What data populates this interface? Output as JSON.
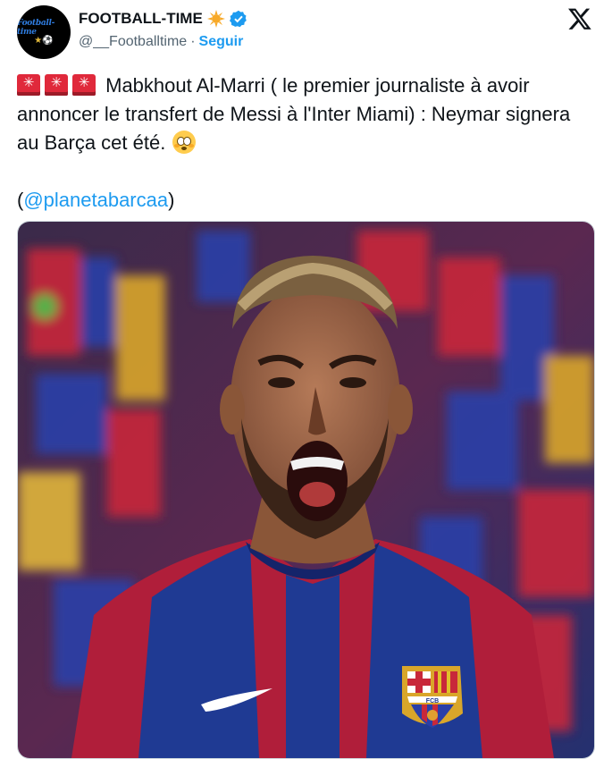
{
  "header": {
    "display_name": "FOOTBALL-TIME",
    "handle": "@__Footballtime",
    "separator": "·",
    "follow_label": "Seguir",
    "avatar_text": "Football-time"
  },
  "tweet": {
    "text_main": "Mabkhout Al-Marri ( le premier journaliste à avoir annoncer le transfert de Messi à l'Inter Miami) : Neymar signera au Barça cet été.",
    "mention": "@planetabarcaa",
    "paren_open": "(",
    "paren_close": ")"
  },
  "media": {
    "crest_text": "FCB"
  },
  "colors": {
    "accent": "#1d9bf0",
    "gold_badge": "#f7a928",
    "verified": "#1d9bf0",
    "barca_blue": "#1f3a93",
    "barca_red": "#b01e3a"
  },
  "icons": [
    "gold-sun-badge-icon",
    "verified-badge-icon",
    "x-logo-icon",
    "rotating-light-icon",
    "flushed-face-icon"
  ]
}
